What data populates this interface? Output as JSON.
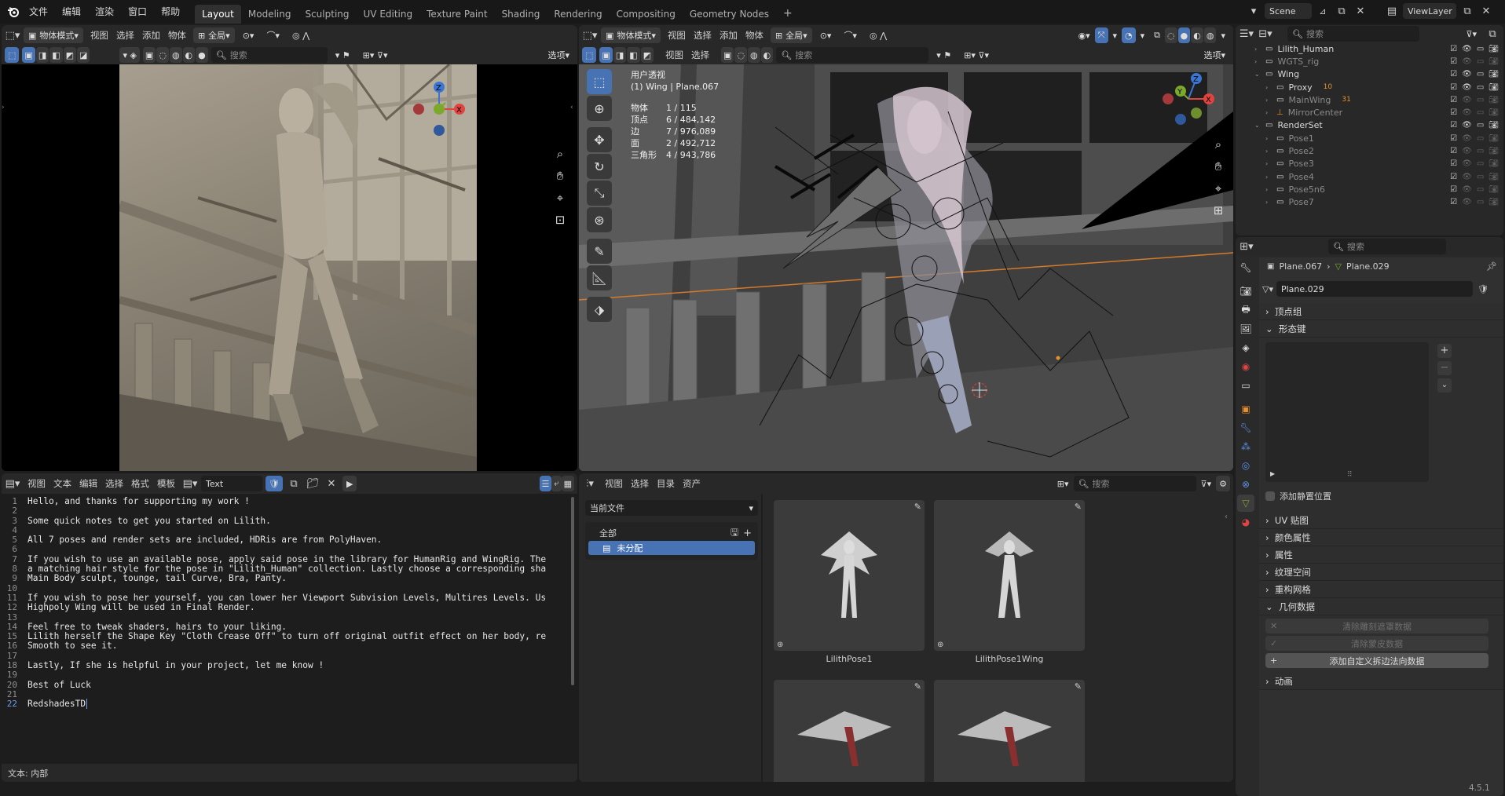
{
  "topbar": {
    "menus": [
      "文件",
      "编辑",
      "渲染",
      "窗口",
      "帮助"
    ],
    "workspaces": [
      "Layout",
      "Modeling",
      "Sculpting",
      "UV Editing",
      "Texture Paint",
      "Shading",
      "Rendering",
      "Compositing",
      "Geometry Nodes"
    ],
    "active_workspace": "Layout",
    "scene_name": "Scene",
    "view_layer": "ViewLayer"
  },
  "viewport_left": {
    "mode": "物体模式",
    "menus": [
      "视图",
      "选择",
      "添加",
      "物体"
    ],
    "transform": "全局",
    "search_placeholder": "搜索",
    "options": "选项"
  },
  "viewport_right": {
    "mode": "物体模式",
    "menus": [
      "视图",
      "选择",
      "添加",
      "物体"
    ],
    "transform": "全局",
    "search_placeholder": "搜索",
    "options": "选项",
    "view_name": "用户透视",
    "object_info": "(1) Wing | Plane.067",
    "stats": [
      {
        "label": "物体",
        "value": "1 / 115"
      },
      {
        "label": "顶点",
        "value": "6 / 484,142"
      },
      {
        "label": "边",
        "value": "7 / 976,089"
      },
      {
        "label": "面",
        "value": "2 / 492,712"
      },
      {
        "label": "三角形",
        "value": "4 / 943,786"
      }
    ]
  },
  "text_editor": {
    "menus": [
      "视图",
      "文本",
      "编辑",
      "选择",
      "格式",
      "模板"
    ],
    "file_name": "Text",
    "status": "文本: 内部",
    "lines": [
      "Hello, and thanks for supporting my work !",
      "",
      "Some quick notes to get you started on Lilith.",
      "",
      "All 7 poses and render sets are included, HDRis are from PolyHaven.",
      "",
      "If you wish to use an available pose, apply said pose in the library for HumanRig and WingRig. The",
      "a matching hair style for the pose in \"Lilith_Human\" collection. Lastly choose a corresponding sha",
      "Main Body sculpt, tounge, tail Curve, Bra, Panty.",
      "",
      "If you wish to pose her yourself, you can lower her Viewport Subvision Levels, Multires Levels. Us",
      "Highpoly Wing will be used in Final Render.",
      "",
      "Feel free to tweak shaders, hairs to your liking.",
      "Lilith herself the Shape Key \"Cloth Crease Off\" to turn off original outfit effect on her body, re",
      "Smooth to see it.",
      "",
      "Lastly, If she is helpful in your project, let me know !",
      "",
      "Best of Luck",
      "",
      "RedshadesTD"
    ]
  },
  "asset_browser": {
    "menus": [
      "视图",
      "选择",
      "目录",
      "资产"
    ],
    "library": "当前文件",
    "search_placeholder": "搜索",
    "catalogs": [
      {
        "label": "全部"
      },
      {
        "label": "未分配"
      }
    ],
    "assets": [
      {
        "name": "LilithPose1"
      },
      {
        "name": "LilithPose1Wing"
      },
      {
        "name": ""
      },
      {
        "name": ""
      }
    ]
  },
  "outliner": {
    "search_placeholder": "搜索",
    "rows": [
      {
        "label": "Lilith_Human",
        "indent": 1,
        "dim": false
      },
      {
        "label": "WGTS_rig",
        "indent": 1,
        "dim": true
      },
      {
        "label": "Wing",
        "indent": 1,
        "dim": false
      },
      {
        "label": "Proxy",
        "indent": 2,
        "dim": false,
        "badge": "10"
      },
      {
        "label": "MainWing",
        "indent": 2,
        "dim": true,
        "badge": "31"
      },
      {
        "label": "MirrorCenter",
        "indent": 2,
        "dim": true
      },
      {
        "label": "RenderSet",
        "indent": 1,
        "dim": false
      },
      {
        "label": "Pose1",
        "indent": 2,
        "dim": true
      },
      {
        "label": "Pose2",
        "indent": 2,
        "dim": true
      },
      {
        "label": "Pose3",
        "indent": 2,
        "dim": true
      },
      {
        "label": "Pose4",
        "indent": 2,
        "dim": true
      },
      {
        "label": "Pose5n6",
        "indent": 2,
        "dim": true
      },
      {
        "label": "Pose7",
        "indent": 2,
        "dim": true
      }
    ]
  },
  "properties": {
    "search_placeholder": "搜索",
    "breadcrumb_object": "Plane.067",
    "breadcrumb_data": "Plane.029",
    "data_name": "Plane.029",
    "sections": {
      "vertex_groups": "顶点组",
      "shape_keys": "形态键",
      "add_rest_position": "添加静置位置",
      "uv_maps": "UV 贴图",
      "color_attributes": "颜色属性",
      "attributes": "属性",
      "texture_space": "纹理空间",
      "remesh": "重构网格",
      "geometry_data": "几何数据",
      "clear_sculpt_mask": "清除雕刻遮罩数据",
      "clear_skin": "清除蒙皮数据",
      "add_split_normals": "添加自定义拆边法向数据",
      "animation": "动画"
    }
  },
  "version": "4.5.1",
  "colors": {
    "accent": "#4772b3",
    "x_axis": "#e3433f",
    "y_axis": "#7ca82b",
    "z_axis": "#3b76d4"
  }
}
